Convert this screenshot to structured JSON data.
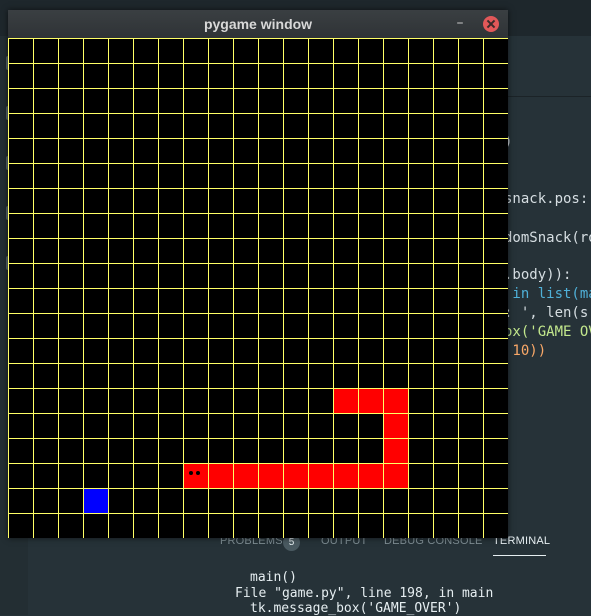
{
  "window": {
    "title": "pygame window",
    "minimize_label": "–"
  },
  "game": {
    "grid_rows": 20,
    "grid_cols": 20,
    "colors": {
      "background": "#000000",
      "grid_lines": "#ffff66",
      "snake": "#ff0000",
      "snack": "#0000ff"
    },
    "snake_head": [
      7,
      17
    ],
    "snake_body": [
      [
        8,
        17
      ],
      [
        9,
        17
      ],
      [
        10,
        17
      ],
      [
        11,
        17
      ],
      [
        12,
        17
      ],
      [
        13,
        17
      ],
      [
        14,
        17
      ],
      [
        15,
        17
      ],
      [
        15,
        16
      ],
      [
        15,
        15
      ],
      [
        14,
        14
      ],
      [
        15,
        14
      ],
      [
        13,
        14
      ]
    ],
    "snack": [
      3,
      18
    ]
  },
  "editor": {
    "code_lines": [
      ")",
      "snack.pos:",
      "domSnack(ro",
      ".body)):",
      " in list(ma",
      ": ', len(s",
      "ox('GAME OV",
      " 10))"
    ]
  },
  "panel": {
    "tabs": [
      "PROBLEMS",
      "OUTPUT",
      "DEBUG CONSOLE",
      "TERMINAL"
    ],
    "problems_count": "5",
    "active_tab": "TERMINAL",
    "terminal_lines": [
      "main()",
      "File \"game.py\", line 198, in main",
      "tk.message_box('GAME_OVER')"
    ]
  }
}
